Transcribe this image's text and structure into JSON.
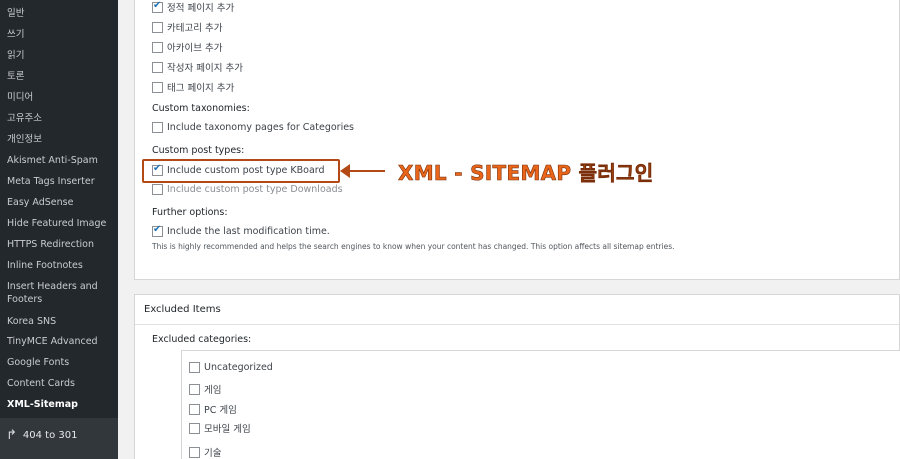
{
  "sidebar": {
    "items": [
      {
        "label": "일반"
      },
      {
        "label": "쓰기"
      },
      {
        "label": "읽기"
      },
      {
        "label": "토론"
      },
      {
        "label": "미디어"
      },
      {
        "label": "고유주소"
      },
      {
        "label": "개인정보"
      },
      {
        "label": "Akismet Anti-Spam"
      },
      {
        "label": "Meta Tags Inserter"
      },
      {
        "label": "Easy AdSense"
      },
      {
        "label": "Hide Featured Image"
      },
      {
        "label": "HTTPS Redirection"
      },
      {
        "label": "Inline Footnotes"
      },
      {
        "label": "Insert Headers and"
      },
      {
        "label": "Footers"
      },
      {
        "label": "Korea SNS"
      },
      {
        "label": "TinyMCE Advanced"
      },
      {
        "label": "Google Fonts"
      },
      {
        "label": "Content Cards"
      },
      {
        "label": "XML-Sitemap"
      }
    ],
    "current": "XML-Sitemap",
    "redirect_label": "404 to 301"
  },
  "content": {
    "pages": [
      {
        "label": "정적 페이지 추가",
        "checked": true
      },
      {
        "label": "카테고리 추가",
        "checked": false
      },
      {
        "label": "아카이브 추가",
        "checked": false
      },
      {
        "label": "작성자 페이지 추가",
        "checked": false
      },
      {
        "label": "태그 페이지 추가",
        "checked": false
      }
    ],
    "custom_taxonomies_label": "Custom taxonomies:",
    "taxonomy_option": {
      "label": "Include taxonomy pages for Categories",
      "checked": false
    },
    "custom_post_types_label": "Custom post types:",
    "post_type_options": [
      {
        "label": "Include custom post type KBoard",
        "checked": true
      },
      {
        "label": "Include custom post type Downloads",
        "checked": false
      }
    ],
    "further_options_label": "Further options:",
    "last_mod_option": {
      "label": "Include the last modification time.",
      "checked": true
    },
    "last_mod_hint": "This is highly recommended and helps the search engines to know when your content has changed. This option affects all sitemap entries."
  },
  "annotation": {
    "text": "XML - SITEMAP 플러그인",
    "color": "#e8651a"
  },
  "excluded": {
    "title": "Excluded Items",
    "categories_label": "Excluded categories:",
    "categories": [
      {
        "label": "Uncategorized",
        "checked": false
      },
      {
        "label": "게임",
        "checked": false
      },
      {
        "label": "PC 게임",
        "checked": false
      },
      {
        "label": "모바일 게임",
        "checked": false
      },
      {
        "label": "기술",
        "checked": false
      }
    ]
  }
}
